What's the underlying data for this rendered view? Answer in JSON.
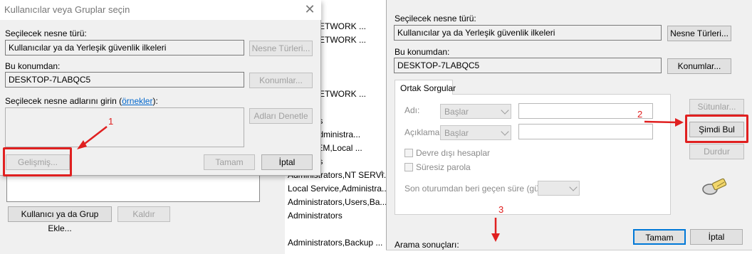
{
  "left_dialog": {
    "title": "Kullanıcılar veya Gruplar seçin",
    "object_type_label": "Seçilecek nesne türü:",
    "object_type_value": "Kullanıcılar ya da Yerleşik güvenlik ilkeleri",
    "object_types_button": "Nesne Türleri...",
    "location_label": "Bu konumdan:",
    "location_value": "DESKTOP-7LABQC5",
    "locations_button": "Konumlar...",
    "names_label_prefix": "Seçilecek nesne adlarını girin (",
    "names_label_link": "örnekler",
    "names_label_suffix": "):",
    "check_names_button": "Adları Denetle",
    "advanced_button": "Gelişmiş...",
    "ok_button": "Tamam",
    "cancel_button": "İptal"
  },
  "background_dialog": {
    "add_button": "Kullanıcı ya da Grup Ekle...",
    "remove_button": "Kaldır"
  },
  "middle_list": [
    "ervice,NETWORK ...",
    "ervice,NETWORK ...",
    "ervice,NETWORK ...",
    "nistrators",
    "ervice,Administra...",
    "a,SYSTEM,Local ...",
    "nistrators",
    "Administrators,NT SERVI...",
    "Local Service,Administra...",
    "Administrators,Users,Ba...",
    "Administrators",
    "Administrators,Backup ..."
  ],
  "right_dialog": {
    "object_type_label": "Seçilecek nesne türü:",
    "object_type_value": "Kullanıcılar ya da Yerleşik güvenlik ilkeleri",
    "object_types_button": "Nesne Türleri...",
    "location_label": "Bu konumdan:",
    "location_value": "DESKTOP-7LABQC5",
    "locations_button": "Konumlar...",
    "tab_label": "Ortak Sorgular",
    "name_label": "Adı:",
    "name_combo": "Başlar",
    "desc_label": "Açıklama:",
    "desc_combo": "Başlar",
    "disabled_accounts": "Devre dışı hesaplar",
    "non_expiring": "Süresiz parola",
    "last_logon_label": "Son oturumdan beri geçen süre (gün):",
    "columns_button": "Sütunlar...",
    "find_now_button": "Şimdi Bul",
    "stop_button": "Durdur",
    "ok_button": "Tamam",
    "cancel_button": "İptal",
    "search_results_label": "Arama sonuçları:"
  },
  "annotations": {
    "n1": "1",
    "n2": "2",
    "n3": "3",
    "color": "#e02020"
  }
}
